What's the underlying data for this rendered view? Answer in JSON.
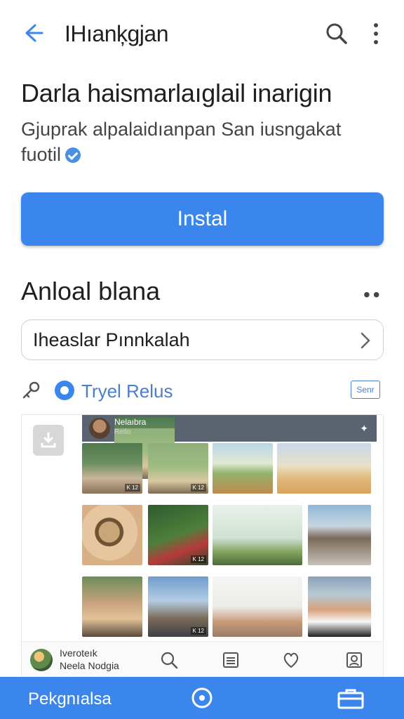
{
  "appbar": {
    "title": "IHıanķgjan",
    "back_icon": "arrow-left-icon",
    "search_icon": "search-icon",
    "more_icon": "more-vertical-icon"
  },
  "header": {
    "headline": "Darla haismarlaıglail inarigin",
    "description": "Gjuprak alpalaidıanpan San iusngakat fuotil"
  },
  "install": {
    "label": "Instal"
  },
  "section": {
    "title": "Anloal blana",
    "more": "••"
  },
  "selector": {
    "label": "Iheaslar Pınnkalah"
  },
  "filter": {
    "text": "Tryel Relus",
    "badge": "Senr"
  },
  "gallery": {
    "header_title": "Nelaıbra",
    "header_sub": "Retlo",
    "tags": [
      "K 12",
      "K 12",
      "K 12",
      "K 12"
    ],
    "footer_line1": "Iveroteık",
    "footer_line2": "Neela Nodgia"
  },
  "bottombar": {
    "label": "Pekgnıalsa"
  },
  "colors": {
    "accent": "#3b86ec",
    "link": "#4a7fcf",
    "header_bar": "#5a6470"
  }
}
